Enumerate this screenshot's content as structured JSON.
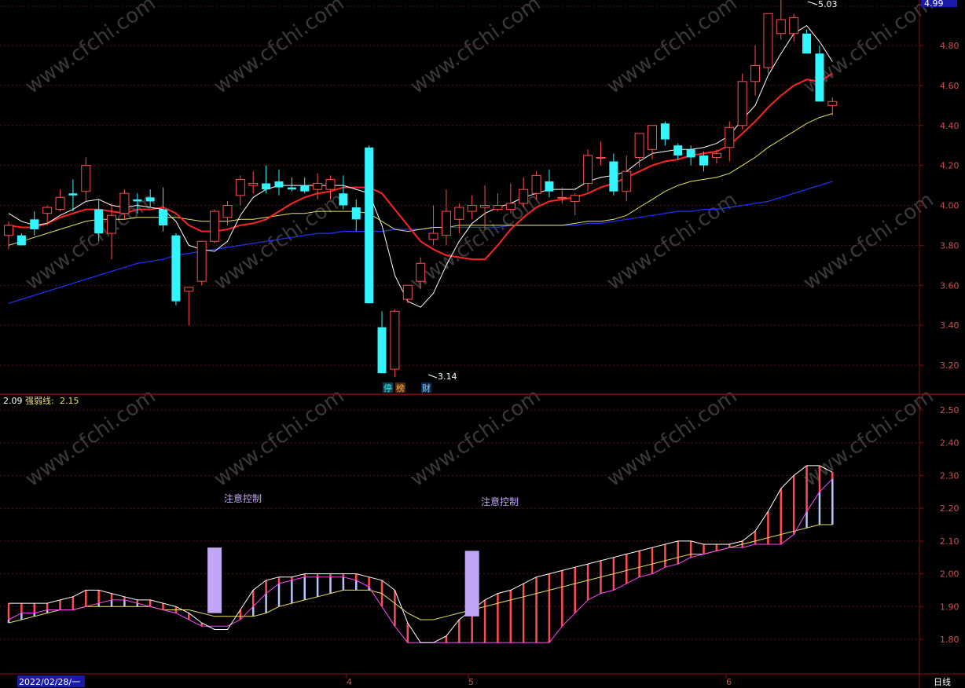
{
  "colors": {
    "background": "#000000",
    "frame": "#8a0c12",
    "grid": "#5a1216",
    "up": "#ff4d4d",
    "down": "#33f5ff",
    "ma_fast": "#ffffff",
    "ma_mid": "#ff2424",
    "ma_slow": "#e8e25a",
    "ma_long": "#2233ff",
    "axis_text": "#d05050",
    "lilac": "#c3a5f7",
    "pale_blue": "#b8c4ff",
    "magenta": "#ff44ff",
    "yellow_text": "#e8e25a",
    "watermark": "#3a3a3a"
  },
  "price_axis": {
    "ticks": [
      "4.80",
      "4.60",
      "4.40",
      "4.20",
      "4.00",
      "3.80",
      "3.60",
      "3.40",
      "3.20"
    ],
    "current": "4.99"
  },
  "indicator_axis": {
    "ticks": [
      "2.50",
      "2.40",
      "2.30",
      "2.20",
      "2.10",
      "2.00",
      "1.90",
      "1.80"
    ]
  },
  "indicator_header": {
    "value": "2.09",
    "name": "强弱线:",
    "name_value": "2.15"
  },
  "annotations": {
    "high": "5.03",
    "low": "3.14",
    "attention_1": "注意控制",
    "attention_2": "注意控制"
  },
  "event_tags": [
    "停",
    "榜",
    "财"
  ],
  "date_axis": {
    "start": "2022/02/28/一",
    "marks": [
      "4",
      "5",
      "6"
    ]
  },
  "period_label": "日线",
  "watermark": "www.cfchi.com",
  "chart_data": [
    {
      "type": "candlestick",
      "ylim": [
        3.1,
        5.03
      ],
      "ohlc": [
        [
          3.85,
          3.92,
          3.78,
          3.9
        ],
        [
          3.85,
          3.86,
          3.8,
          3.8
        ],
        [
          3.93,
          3.97,
          3.85,
          3.88
        ],
        [
          3.96,
          4.0,
          3.9,
          3.99
        ],
        [
          3.98,
          4.08,
          3.97,
          4.04
        ],
        [
          4.06,
          4.13,
          3.97,
          4.05
        ],
        [
          4.07,
          4.24,
          4.02,
          4.2
        ],
        [
          3.98,
          4.03,
          3.82,
          3.86
        ],
        [
          3.86,
          4.01,
          3.73,
          3.95
        ],
        [
          3.96,
          4.08,
          3.93,
          4.06
        ],
        [
          4.03,
          4.06,
          3.96,
          4.02
        ],
        [
          4.04,
          4.08,
          3.99,
          4.02
        ],
        [
          3.98,
          4.09,
          3.87,
          3.9
        ],
        [
          3.85,
          3.86,
          3.5,
          3.52
        ],
        [
          3.57,
          3.58,
          3.4,
          3.59
        ],
        [
          3.62,
          3.78,
          3.6,
          3.82
        ],
        [
          3.82,
          3.98,
          3.81,
          3.97
        ],
        [
          3.94,
          4.02,
          3.9,
          4.0
        ],
        [
          4.05,
          4.15,
          4.0,
          4.13
        ],
        [
          4.1,
          4.17,
          4.06,
          4.11
        ],
        [
          4.11,
          4.2,
          4.06,
          4.08
        ],
        [
          4.12,
          4.18,
          4.05,
          4.09
        ],
        [
          4.09,
          4.14,
          4.07,
          4.08
        ],
        [
          4.1,
          4.14,
          4.06,
          4.07
        ],
        [
          4.08,
          4.16,
          4.03,
          4.11
        ],
        [
          4.08,
          4.15,
          4.03,
          4.13
        ],
        [
          4.06,
          4.15,
          3.98,
          4.0
        ],
        [
          3.99,
          4.03,
          3.87,
          3.93
        ],
        [
          4.29,
          4.3,
          3.52,
          3.51
        ],
        [
          3.39,
          3.47,
          3.16,
          3.16
        ],
        [
          3.18,
          3.48,
          3.14,
          3.47
        ],
        [
          3.53,
          3.58,
          3.51,
          3.6
        ],
        [
          3.62,
          3.74,
          3.58,
          3.71
        ],
        [
          3.83,
          4.0,
          3.8,
          3.86
        ],
        [
          3.85,
          4.08,
          3.8,
          3.97
        ],
        [
          3.93,
          4.01,
          3.86,
          3.99
        ],
        [
          3.97,
          4.05,
          3.93,
          4.0
        ],
        [
          3.99,
          4.1,
          3.88,
          4.0
        ],
        [
          3.98,
          4.06,
          3.97,
          4.0
        ],
        [
          3.98,
          4.11,
          3.96,
          4.01
        ],
        [
          4.01,
          4.14,
          3.99,
          4.08
        ],
        [
          4.06,
          4.17,
          4.03,
          4.15
        ],
        [
          4.12,
          4.18,
          4.04,
          4.07
        ],
        [
          4.04,
          4.09,
          4.01,
          4.04
        ],
        [
          4.02,
          4.06,
          3.95,
          4.05
        ],
        [
          4.11,
          4.28,
          4.07,
          4.25
        ],
        [
          4.24,
          4.32,
          4.2,
          4.24
        ],
        [
          4.22,
          4.26,
          4.05,
          4.07
        ],
        [
          4.07,
          4.25,
          4.02,
          4.17
        ],
        [
          4.24,
          4.35,
          4.19,
          4.36
        ],
        [
          4.28,
          4.39,
          4.23,
          4.4
        ],
        [
          4.41,
          4.42,
          4.3,
          4.33
        ],
        [
          4.3,
          4.31,
          4.23,
          4.25
        ],
        [
          4.28,
          4.3,
          4.2,
          4.24
        ],
        [
          4.25,
          4.27,
          4.17,
          4.2
        ],
        [
          4.24,
          4.28,
          4.21,
          4.26
        ],
        [
          4.29,
          4.42,
          4.22,
          4.39
        ],
        [
          4.4,
          4.66,
          4.38,
          4.62
        ],
        [
          4.62,
          4.8,
          4.55,
          4.7
        ],
        [
          4.69,
          4.96,
          4.66,
          4.96
        ],
        [
          4.86,
          5.03,
          4.83,
          4.93
        ],
        [
          4.86,
          4.96,
          4.82,
          4.94
        ],
        [
          4.86,
          4.88,
          4.78,
          4.76
        ],
        [
          4.76,
          4.8,
          4.58,
          4.52
        ],
        [
          4.5,
          4.54,
          4.45,
          4.52
        ]
      ],
      "ma_fast": [
        3.96,
        3.92,
        3.9,
        3.91,
        3.95,
        3.98,
        4.02,
        4.03,
        4.0,
        3.99,
        4.0,
        3.99,
        3.98,
        3.92,
        3.8,
        3.78,
        3.77,
        3.82,
        3.95,
        4.04,
        4.08,
        4.1,
        4.1,
        4.1,
        4.1,
        4.1,
        4.1,
        4.08,
        4.06,
        3.9,
        3.65,
        3.52,
        3.49,
        3.56,
        3.7,
        3.82,
        3.91,
        3.96,
        3.99,
        4.01,
        4.04,
        4.06,
        4.08,
        4.08,
        4.08,
        4.12,
        4.14,
        4.15,
        4.17,
        4.22,
        4.26,
        4.27,
        4.28,
        4.28,
        4.29,
        4.31,
        4.35,
        4.43,
        4.5,
        4.65,
        4.76,
        4.86,
        4.9,
        4.82,
        4.72
      ],
      "ma_mid": [
        3.9,
        3.89,
        3.89,
        3.91,
        3.94,
        3.96,
        3.98,
        3.98,
        3.97,
        3.96,
        3.98,
        3.98,
        3.99,
        3.96,
        3.9,
        3.87,
        3.87,
        3.88,
        3.9,
        3.91,
        3.93,
        3.97,
        4.01,
        4.04,
        4.06,
        4.07,
        4.09,
        4.09,
        4.09,
        4.06,
        3.98,
        3.9,
        3.82,
        3.78,
        3.75,
        3.74,
        3.73,
        3.73,
        3.8,
        3.88,
        3.94,
        3.99,
        4.02,
        4.03,
        4.04,
        4.06,
        4.09,
        4.11,
        4.14,
        4.17,
        4.2,
        4.22,
        4.23,
        4.25,
        4.26,
        4.27,
        4.3,
        4.36,
        4.42,
        4.49,
        4.55,
        4.6,
        4.63,
        4.62,
        4.66
      ],
      "ma_slow": [
        3.8,
        3.82,
        3.84,
        3.86,
        3.88,
        3.9,
        3.92,
        3.93,
        3.93,
        3.93,
        3.94,
        3.94,
        3.94,
        3.94,
        3.93,
        3.92,
        3.92,
        3.92,
        3.93,
        3.93,
        3.94,
        3.95,
        3.96,
        3.96,
        3.97,
        3.97,
        3.97,
        3.97,
        3.96,
        3.92,
        3.88,
        3.87,
        3.88,
        3.89,
        3.89,
        3.9,
        3.9,
        3.9,
        3.9,
        3.9,
        3.9,
        3.9,
        3.9,
        3.9,
        3.91,
        3.92,
        3.92,
        3.93,
        3.95,
        3.99,
        4.03,
        4.07,
        4.1,
        4.12,
        4.13,
        4.14,
        4.16,
        4.2,
        4.24,
        4.29,
        4.33,
        4.37,
        4.41,
        4.44,
        4.46
      ],
      "ma_long": [
        3.51,
        3.53,
        3.55,
        3.57,
        3.59,
        3.61,
        3.63,
        3.65,
        3.67,
        3.69,
        3.71,
        3.72,
        3.73,
        3.75,
        3.76,
        3.77,
        3.78,
        3.79,
        3.8,
        3.81,
        3.82,
        3.83,
        3.84,
        3.85,
        3.86,
        3.86,
        3.87,
        3.87,
        3.87,
        3.87,
        3.88,
        3.88,
        3.88,
        3.89,
        3.89,
        3.89,
        3.89,
        3.89,
        3.89,
        3.9,
        3.9,
        3.9,
        3.9,
        3.9,
        3.9,
        3.91,
        3.91,
        3.92,
        3.93,
        3.94,
        3.95,
        3.96,
        3.97,
        3.97,
        3.98,
        3.98,
        3.99,
        4.0,
        4.01,
        4.02,
        4.04,
        4.06,
        4.08,
        4.1,
        4.12
      ]
    },
    {
      "type": "area",
      "ylim": [
        1.77,
        2.53
      ],
      "upper": [
        1.91,
        1.91,
        1.91,
        1.91,
        1.92,
        1.93,
        1.95,
        1.95,
        1.94,
        1.93,
        1.92,
        1.92,
        1.91,
        1.9,
        1.88,
        1.85,
        1.83,
        1.83,
        1.89,
        1.95,
        1.98,
        1.99,
        1.99,
        2.0,
        2.0,
        2.0,
        2.0,
        2.0,
        1.99,
        1.98,
        1.95,
        1.85,
        1.79,
        1.79,
        1.81,
        1.86,
        1.89,
        1.92,
        1.94,
        1.95,
        1.97,
        1.99,
        2.0,
        2.01,
        2.02,
        2.03,
        2.04,
        2.05,
        2.06,
        2.07,
        2.08,
        2.09,
        2.1,
        2.1,
        2.09,
        2.09,
        2.09,
        2.1,
        2.13,
        2.19,
        2.26,
        2.3,
        2.33,
        2.33,
        2.31
      ],
      "lower": [
        1.86,
        1.88,
        1.88,
        1.89,
        1.89,
        1.89,
        1.9,
        1.91,
        1.92,
        1.92,
        1.91,
        1.9,
        1.89,
        1.88,
        1.86,
        1.84,
        1.84,
        1.84,
        1.86,
        1.9,
        1.94,
        1.97,
        1.98,
        1.99,
        1.99,
        1.99,
        1.99,
        1.98,
        1.96,
        1.9,
        1.84,
        1.79,
        1.79,
        1.79,
        1.79,
        1.79,
        1.79,
        1.79,
        1.79,
        1.79,
        1.79,
        1.79,
        1.79,
        1.84,
        1.88,
        1.92,
        1.94,
        1.95,
        1.97,
        1.99,
        2.0,
        2.02,
        2.03,
        2.05,
        2.06,
        2.07,
        2.08,
        2.08,
        2.09,
        2.09,
        2.09,
        2.12,
        2.19,
        2.25,
        2.29
      ],
      "strength_line": [
        1.85,
        1.86,
        1.87,
        1.88,
        1.89,
        1.89,
        1.9,
        1.9,
        1.9,
        1.9,
        1.9,
        1.9,
        1.89,
        1.89,
        1.89,
        1.88,
        1.87,
        1.87,
        1.87,
        1.87,
        1.88,
        1.9,
        1.91,
        1.92,
        1.93,
        1.94,
        1.95,
        1.95,
        1.95,
        1.94,
        1.91,
        1.88,
        1.86,
        1.86,
        1.87,
        1.88,
        1.89,
        1.9,
        1.91,
        1.92,
        1.93,
        1.94,
        1.95,
        1.96,
        1.97,
        1.98,
        1.99,
        2.0,
        2.01,
        2.02,
        2.03,
        2.04,
        2.05,
        2.06,
        2.06,
        2.07,
        2.08,
        2.09,
        2.1,
        2.11,
        2.12,
        2.13,
        2.14,
        2.15,
        2.15
      ],
      "spikes": [
        {
          "index": 16,
          "from": 1.88,
          "to": 2.08
        },
        {
          "index": 36,
          "from": 1.87,
          "to": 2.07
        }
      ]
    }
  ]
}
